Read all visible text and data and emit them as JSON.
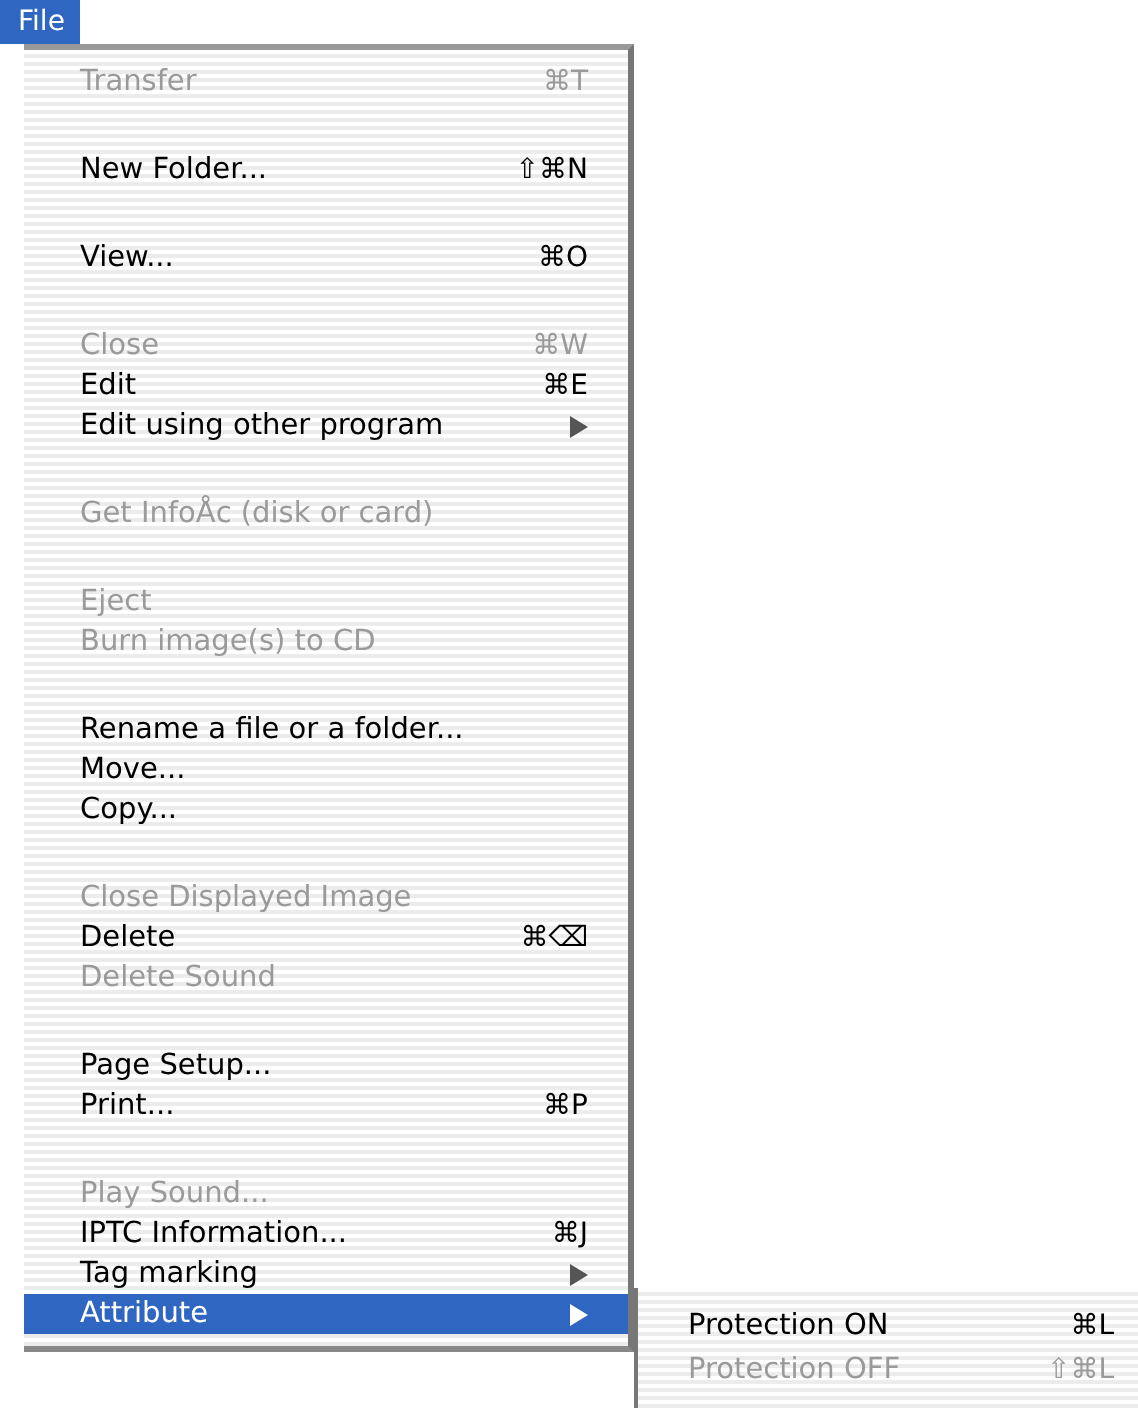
{
  "menu_bar": {
    "title": "File",
    "selected": true
  },
  "menu": {
    "groups": [
      [
        {
          "label": "Transfer",
          "shortcut": "⌘T",
          "disabled": true,
          "submenu": false,
          "selected": false
        }
      ],
      [
        {
          "label": "New Folder...",
          "shortcut": "⇧⌘N",
          "disabled": false,
          "submenu": false,
          "selected": false
        }
      ],
      [
        {
          "label": "View...",
          "shortcut": "⌘O",
          "disabled": false,
          "submenu": false,
          "selected": false
        }
      ],
      [
        {
          "label": "Close",
          "shortcut": "⌘W",
          "disabled": true,
          "submenu": false,
          "selected": false
        },
        {
          "label": "Edit",
          "shortcut": "⌘E",
          "disabled": false,
          "submenu": false,
          "selected": false
        },
        {
          "label": "Edit using other program",
          "disabled": false,
          "submenu": true,
          "selected": false
        }
      ],
      [
        {
          "label": "Get InfoÅc (disk or card)",
          "disabled": true,
          "submenu": false,
          "selected": false
        }
      ],
      [
        {
          "label": "Eject",
          "disabled": true,
          "submenu": false,
          "selected": false
        },
        {
          "label": "Burn image(s) to CD",
          "disabled": true,
          "submenu": false,
          "selected": false
        }
      ],
      [
        {
          "label": "Rename a file or a folder...",
          "disabled": false,
          "submenu": false,
          "selected": false
        },
        {
          "label": "Move...",
          "disabled": false,
          "submenu": false,
          "selected": false
        },
        {
          "label": "Copy...",
          "disabled": false,
          "submenu": false,
          "selected": false
        }
      ],
      [
        {
          "label": "Close Displayed Image",
          "disabled": true,
          "submenu": false,
          "selected": false
        },
        {
          "label": "Delete",
          "shortcut": "⌘⌫",
          "disabled": false,
          "submenu": false,
          "selected": false
        },
        {
          "label": "Delete Sound",
          "disabled": true,
          "submenu": false,
          "selected": false
        }
      ],
      [
        {
          "label": "Page Setup...",
          "disabled": false,
          "submenu": false,
          "selected": false
        },
        {
          "label": "Print...",
          "shortcut": "⌘P",
          "disabled": false,
          "submenu": false,
          "selected": false
        }
      ],
      [
        {
          "label": "Play Sound...",
          "disabled": true,
          "submenu": false,
          "selected": false
        },
        {
          "label": "IPTC Information...",
          "shortcut": "⌘J",
          "disabled": false,
          "submenu": false,
          "selected": false
        },
        {
          "label": "Tag marking",
          "disabled": false,
          "submenu": true,
          "selected": false
        },
        {
          "label": "Attribute",
          "disabled": false,
          "submenu": true,
          "selected": true
        }
      ]
    ]
  },
  "submenu": {
    "items": [
      {
        "label": "Protection ON",
        "shortcut": "⌘L",
        "disabled": false,
        "selected": false
      },
      {
        "label": "Protection OFF",
        "shortcut": "⇧⌘L",
        "disabled": true,
        "selected": false
      }
    ]
  }
}
